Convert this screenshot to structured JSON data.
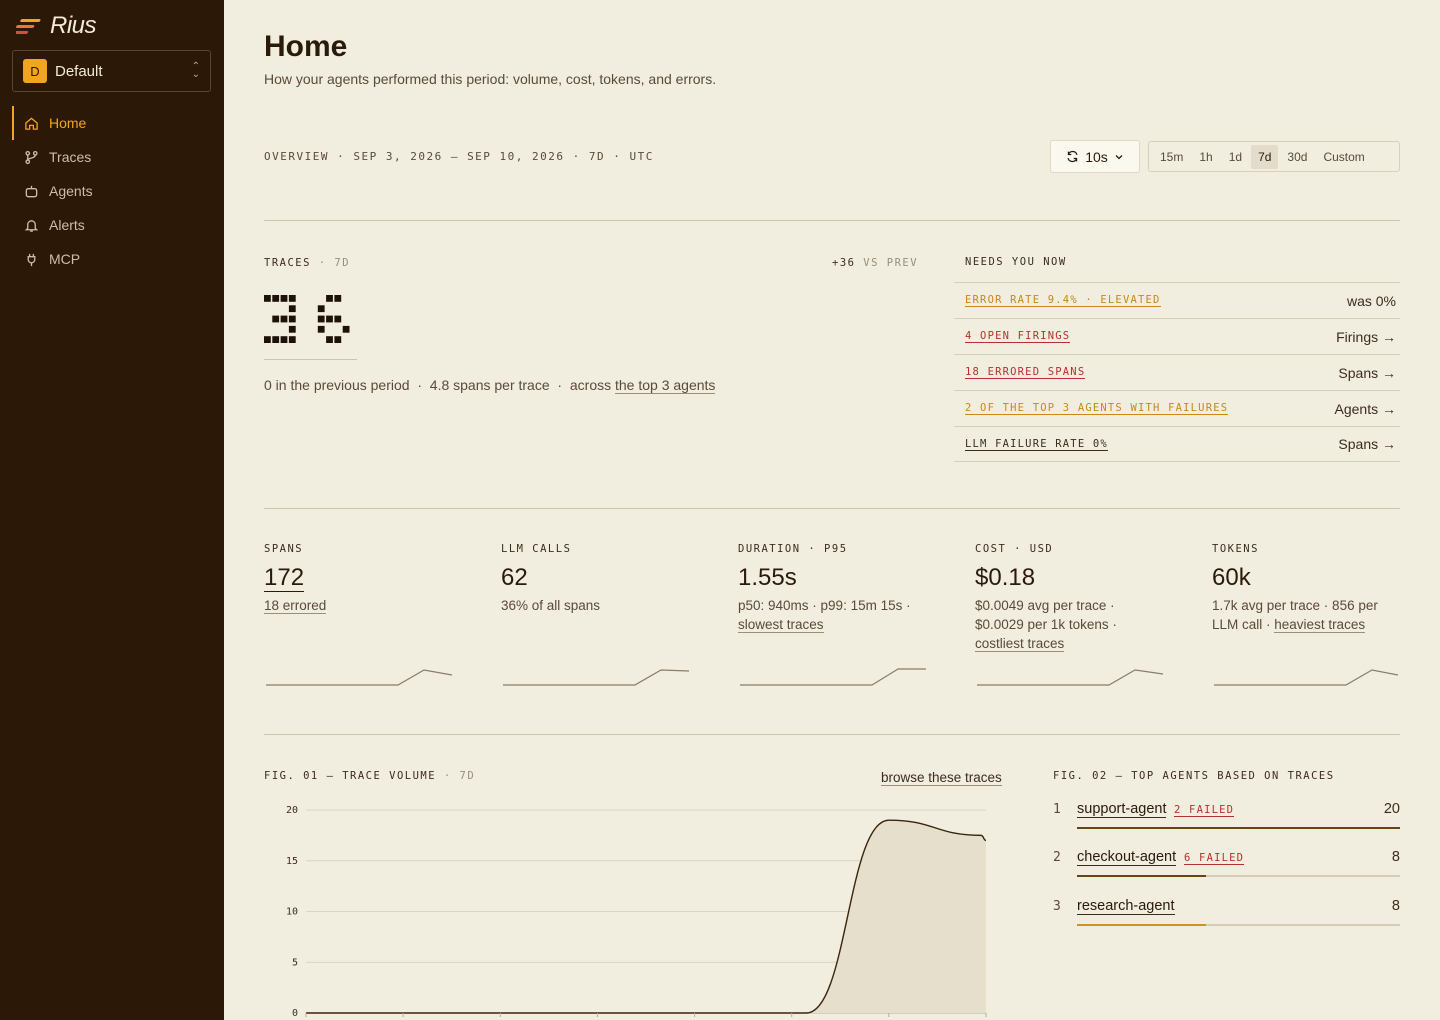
{
  "app": {
    "name": "Rius"
  },
  "workspace": {
    "badge": "D",
    "name": "Default"
  },
  "nav": [
    {
      "label": "Home",
      "icon": "home-icon",
      "active": true
    },
    {
      "label": "Traces",
      "icon": "traces-icon",
      "active": false
    },
    {
      "label": "Agents",
      "icon": "bot-icon",
      "active": false
    },
    {
      "label": "Alerts",
      "icon": "bell-icon",
      "active": false
    },
    {
      "label": "MCP",
      "icon": "plug-icon",
      "active": false
    }
  ],
  "page": {
    "title": "Home",
    "subtitle": "How your agents performed this period: volume, cost, tokens, and errors.",
    "overview": "OVERVIEW · SEP 3, 2026 – SEP 10, 2026 · 7D · UTC"
  },
  "controls": {
    "refresh": "10s",
    "ranges": [
      "15m",
      "1h",
      "1d",
      "7d",
      "30d",
      "Custom"
    ],
    "selected_range": "7d"
  },
  "traces": {
    "label": "TRACES",
    "window": "· 7D",
    "delta": "+36",
    "delta_suffix": "VS PREV",
    "count": 36,
    "prev_text": "0 in the previous period",
    "spans_text": "4.8 spans per trace",
    "across_text": "across",
    "agents_link": "the top 3 agents"
  },
  "needs": {
    "label": "NEEDS YOU NOW",
    "rows": [
      {
        "key": "ERROR RATE 9.4% · ELEVATED",
        "value": "was 0%",
        "tone": "orange"
      },
      {
        "key": "4 OPEN FIRINGS",
        "value": "Firings →",
        "tone": "red"
      },
      {
        "key": "18 ERRORED SPANS",
        "value": "Spans →",
        "tone": "red"
      },
      {
        "key": "2 OF THE TOP 3 AGENTS WITH FAILURES",
        "value": "Agents →",
        "tone": "orange"
      },
      {
        "key": "LLM FAILURE RATE 0%",
        "value": "Spans →",
        "tone": "dark"
      }
    ]
  },
  "stats": {
    "spans": {
      "label": "SPANS",
      "value": "172",
      "sub_link": "18 errored"
    },
    "llm": {
      "label": "LLM CALLS",
      "value": "62",
      "sub": "36% of all spans"
    },
    "duration": {
      "label": "DURATION",
      "label2": "· P95",
      "value": "1.55s",
      "sub": "p50: 940ms · p99: 15m 15s ·",
      "link": "slowest traces"
    },
    "cost": {
      "label": "COST",
      "label2": "· USD",
      "value": "$0.18",
      "sub1": "$0.0049 avg per trace ·",
      "sub2": "$0.0029 per 1k tokens ·",
      "link": "costliest traces"
    },
    "tokens": {
      "label": "TOKENS",
      "value": "60k",
      "sub1": "1.7k avg per trace · 856 per",
      "sub2": "LLM call ·",
      "link": "heaviest traces"
    }
  },
  "fig1": {
    "label": "FIG. 01 — TRACE VOLUME",
    "window": "· 7D",
    "browse": "browse these traces"
  },
  "chart_data": {
    "type": "area",
    "title": "FIG. 01 — TRACE VOLUME",
    "ylim": [
      0,
      20
    ],
    "yticks": [
      0,
      5,
      10,
      15,
      20
    ],
    "x": [
      0,
      1,
      2,
      3,
      4,
      5,
      5.15,
      6,
      6.95,
      7
    ],
    "y": [
      0,
      0,
      0,
      0,
      0,
      0,
      0,
      19,
      17.5,
      17
    ],
    "grid": true
  },
  "fig2": {
    "label": "FIG. 02 — TOP AGENTS BASED ON TRACES",
    "agents": [
      {
        "rank": "1",
        "name": "support-agent",
        "failed": "2 FAILED",
        "count": 20,
        "color": "#6b4413"
      },
      {
        "rank": "2",
        "name": "checkout-agent",
        "failed": "6 FAILED",
        "count": 8,
        "color": "#6b4413"
      },
      {
        "rank": "3",
        "name": "research-agent",
        "failed": "",
        "count": 8,
        "color": "#d4901d"
      }
    ]
  },
  "colors": {
    "accent": "#f2a51f",
    "sidebar": "#2b1807",
    "background": "#f1eddf",
    "red": "#b5322c",
    "orange": "#c8881c"
  }
}
